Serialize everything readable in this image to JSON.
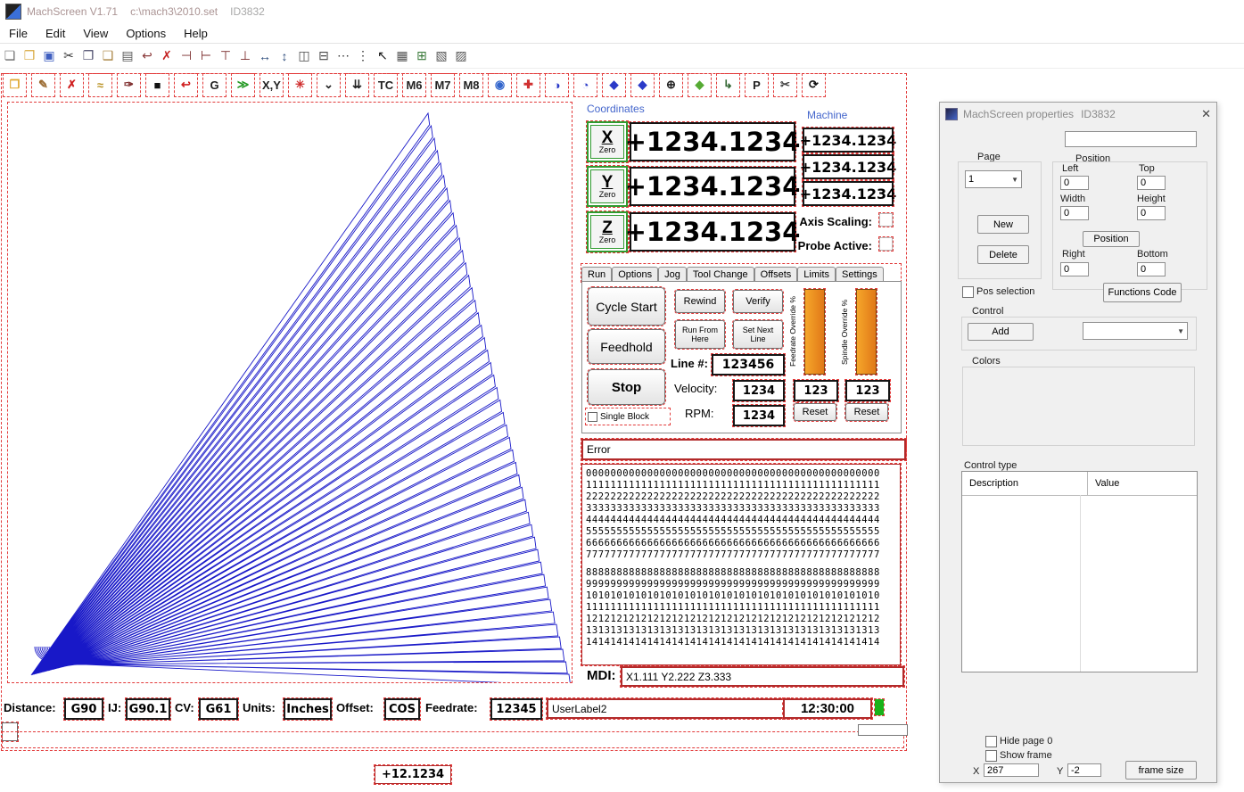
{
  "window": {
    "title": "MachScreen V1.71",
    "file": "c:\\mach3\\2010.set",
    "id": "ID3832"
  },
  "menu": [
    "File",
    "Edit",
    "View",
    "Options",
    "Help"
  ],
  "toolbar_main": [
    {
      "name": "new-file",
      "glyph": "❏",
      "color": "#6b6b6b"
    },
    {
      "name": "open-folder",
      "glyph": "❒",
      "color": "#d9a93f"
    },
    {
      "name": "save",
      "glyph": "▣",
      "color": "#3f5fc0"
    },
    {
      "name": "cut",
      "glyph": "✂",
      "color": "#3a3a3a"
    },
    {
      "name": "copy",
      "glyph": "❐",
      "color": "#4a4a6a"
    },
    {
      "name": "paste",
      "glyph": "❑",
      "color": "#a8813e"
    },
    {
      "name": "print",
      "glyph": "▤",
      "color": "#5a5a5a"
    },
    {
      "name": "undo",
      "glyph": "↩",
      "color": "#8a3a3a"
    },
    {
      "name": "delete",
      "glyph": "✗",
      "color": "#c42222"
    },
    {
      "name": "align-left",
      "glyph": "⊣",
      "color": "#7a2a2a"
    },
    {
      "name": "align-right",
      "glyph": "⊢",
      "color": "#7a2a2a"
    },
    {
      "name": "align-top",
      "glyph": "⊤",
      "color": "#7a2a2a"
    },
    {
      "name": "align-bottom",
      "glyph": "⊥",
      "color": "#7a2a2a"
    },
    {
      "name": "same-width",
      "glyph": "↔",
      "color": "#2a4a7a"
    },
    {
      "name": "same-height",
      "glyph": "↕",
      "color": "#2a4a7a"
    },
    {
      "name": "center-horizontal",
      "glyph": "◫",
      "color": "#4a4a4a"
    },
    {
      "name": "center-vertical",
      "glyph": "⊟",
      "color": "#4a4a4a"
    },
    {
      "name": "space-across",
      "glyph": "⋯",
      "color": "#333333"
    },
    {
      "name": "space-down",
      "glyph": "⋮",
      "color": "#333333"
    },
    {
      "name": "select-pointer",
      "glyph": "↖",
      "color": "#111111"
    },
    {
      "name": "grid",
      "glyph": "▦",
      "color": "#555555"
    },
    {
      "name": "tab-order",
      "glyph": "⊞",
      "color": "#3a7a3a"
    },
    {
      "name": "bring-to-front",
      "glyph": "▧",
      "color": "#555555"
    },
    {
      "name": "send-to-back",
      "glyph": "▨",
      "color": "#555555"
    }
  ],
  "toolbar_screen": [
    {
      "name": "open-screen",
      "glyph": "❒",
      "color": "#e0a830"
    },
    {
      "name": "edit-screen",
      "glyph": "✎",
      "color": "#9a6a30"
    },
    {
      "name": "close-screen",
      "glyph": "✗",
      "color": "#d02020"
    },
    {
      "name": "signal",
      "glyph": "≈",
      "color": "#b89020"
    },
    {
      "name": "color-picker",
      "glyph": "✑",
      "color": "#803030"
    },
    {
      "name": "fill-black",
      "glyph": "■",
      "color": "#111111"
    },
    {
      "name": "undo-red",
      "glyph": "↩",
      "color": "#d02020"
    },
    {
      "name": "gcode",
      "glyph": "G",
      "color": "#222222"
    },
    {
      "name": "wizard",
      "glyph": "≫",
      "color": "#229922"
    },
    {
      "name": "xy-coords",
      "glyph": "X,Y",
      "color": "#222222"
    },
    {
      "name": "flash",
      "glyph": "✳",
      "color": "#d03030"
    },
    {
      "name": "step-down",
      "glyph": "⌄",
      "color": "#222222"
    },
    {
      "name": "multi-step-down",
      "glyph": "⇊",
      "color": "#222222"
    },
    {
      "name": "tool-change",
      "glyph": "TC",
      "color": "#222222"
    },
    {
      "name": "m6",
      "glyph": "M6",
      "color": "#222222"
    },
    {
      "name": "m7",
      "glyph": "M7",
      "color": "#222222"
    },
    {
      "name": "m8",
      "glyph": "M8",
      "color": "#222222"
    },
    {
      "name": "camera",
      "glyph": "◉",
      "color": "#3366cc"
    },
    {
      "name": "cross",
      "glyph": "✚",
      "color": "#d03030"
    },
    {
      "name": "feed-orb",
      "glyph": "◑",
      "color": "#2a3ac8"
    },
    {
      "name": "spindle-orb",
      "glyph": "◔",
      "color": "#2a3ac8"
    },
    {
      "name": "jog-diamond",
      "glyph": "◆",
      "color": "#2a3ac8"
    },
    {
      "name": "axis-diamond",
      "glyph": "◆",
      "color": "#2a3ac8"
    },
    {
      "name": "target",
      "glyph": "⊕",
      "color": "#222222"
    },
    {
      "name": "verify-shield",
      "glyph": "◆",
      "color": "#55aa33"
    },
    {
      "name": "flip",
      "glyph": "↳",
      "color": "#336633"
    },
    {
      "name": "program",
      "glyph": "P",
      "color": "#222222"
    },
    {
      "name": "scissors",
      "glyph": "✂",
      "color": "#444444"
    },
    {
      "name": "regen",
      "glyph": "⟳",
      "color": "#111111"
    }
  ],
  "coords": {
    "title": "Coordinates",
    "machine_title": "Machine",
    "axes": [
      {
        "letter": "X",
        "zero": "Zero",
        "value": "+1234.1234"
      },
      {
        "letter": "Y",
        "zero": "Zero",
        "value": "+1234.1234"
      },
      {
        "letter": "Z",
        "zero": "Zero",
        "value": "+1234.1234"
      }
    ],
    "machine_values": [
      "+1234.1234",
      "+1234.1234",
      "+1234.1234"
    ],
    "axis_scaling_label": "Axis Scaling:",
    "probe_active_label": "Probe Active:"
  },
  "tabs": [
    "Run",
    "Options",
    "Jog",
    "Tool Change",
    "Offsets",
    "Limits",
    "Settings"
  ],
  "run": {
    "cycle_start": "Cycle Start",
    "feedhold": "Feedhold",
    "stop": "Stop",
    "single_block": "Single Block",
    "rewind": "Rewind",
    "verify": "Verify",
    "run_from_here": "Run From Here",
    "set_next_line": "Set Next Line",
    "line_label": "Line #:",
    "line_value": "123456",
    "velocity_label": "Velocity:",
    "velocity_value": "1234",
    "rpm_label": "RPM:",
    "rpm_value": "1234",
    "feedrate_override_label": "Feedrate Override %",
    "spindle_override_label": "Spindle Override %",
    "fro_value": "123",
    "sro_value": "123",
    "reset_label": "Reset"
  },
  "error_value": "Error",
  "gcode_lines": [
    "000000000000000000000000000000000000000000000000",
    "111111111111111111111111111111111111111111111111",
    "222222222222222222222222222222222222222222222222",
    "333333333333333333333333333333333333333333333333",
    "444444444444444444444444444444444444444444444444",
    "555555555555555555555555555555555555555555555555",
    "666666666666666666666666666666666666666666666666",
    "777777777777777777777777777777777777777777777777",
    "888888888888888888888888888888888888888888888888",
    "999999999999999999999999999999999999999999999999",
    "101010101010101010101010101010101010101010101010",
    "111111111111111111111111111111111111111111111111",
    "121212121212121212121212121212121212121212121212",
    "131313131313131313131313131313131313131313131313",
    "141414141414141414141414141414141414141414141414"
  ],
  "mdi": {
    "label": "MDI:",
    "value": "X1.111 Y2.222 Z3.333"
  },
  "status": {
    "distance_label": "Distance:",
    "distance": "G90",
    "ij_label": "IJ:",
    "ij": "G90.1",
    "cv_label": "CV:",
    "cv": "G61",
    "units_label": "Units:",
    "units": "Inches",
    "offset_label": "Offset:",
    "offset": "COS",
    "feedrate_label": "Feedrate:",
    "feedrate": "12345",
    "user_label": "UserLabel2",
    "time": "12:30:00"
  },
  "bottom_dro": "+12.1234",
  "properties": {
    "title": "MachScreen properties",
    "id": "ID3832",
    "close": "✕",
    "page_label": "Page",
    "page_value": "1",
    "position_label": "Position",
    "left_label": "Left",
    "left": "0",
    "top_label": "Top",
    "top": "0",
    "width_label": "Width",
    "width": "0",
    "height_label": "Height",
    "height": "0",
    "right_label": "Right",
    "right": "0",
    "bottom_label": "Bottom",
    "bottom": "0",
    "new": "New",
    "delete": "Delete",
    "position_btn": "Position",
    "pos_selection": "Pos selection",
    "functions_code": "Functions Code",
    "control_label": "Control",
    "add": "Add",
    "colors_label": "Colors",
    "control_type_label": "Control type",
    "table": {
      "columns": [
        "Description",
        "Value"
      ]
    },
    "hide_page": "Hide page 0",
    "show_frame": "Show frame",
    "x_label": "X",
    "x": "267",
    "y_label": "Y",
    "y": "-2",
    "frame_size": "frame size"
  }
}
